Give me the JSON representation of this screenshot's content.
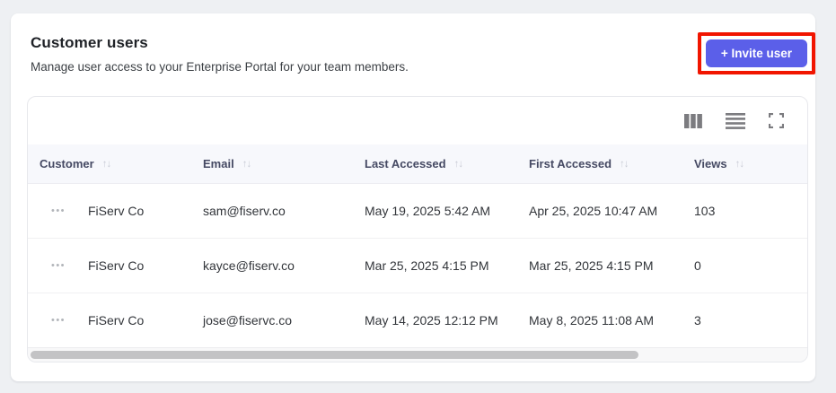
{
  "header": {
    "title": "Customer users",
    "subtitle": "Manage user access to your Enterprise Portal for your team members.",
    "invite_button_label": "+ Invite user"
  },
  "toolbar": {
    "icons": [
      "columns-icon",
      "row-density-icon",
      "fullscreen-icon"
    ]
  },
  "icons": {
    "sort_asc": "↑",
    "sort_desc": "↓",
    "row_menu": "•••"
  },
  "table": {
    "columns": [
      {
        "label": "Customer"
      },
      {
        "label": "Email"
      },
      {
        "label": "Last Accessed"
      },
      {
        "label": "First Accessed"
      },
      {
        "label": "Views"
      }
    ],
    "rows": [
      {
        "customer": "FiServ Co",
        "email": "sam@fiserv.co",
        "last_accessed": "May 19, 2025 5:42 AM",
        "first_accessed": "Apr 25, 2025 10:47 AM",
        "views": "103"
      },
      {
        "customer": "FiServ Co",
        "email": "kayce@fiserv.co",
        "last_accessed": "Mar 25, 2025 4:15 PM",
        "first_accessed": "Mar 25, 2025 4:15 PM",
        "views": "0"
      },
      {
        "customer": "FiServ Co",
        "email": "jose@fiservc.co",
        "last_accessed": "May 14, 2025 12:12 PM",
        "first_accessed": "May 8, 2025 11:08 AM",
        "views": "3"
      }
    ]
  },
  "colors": {
    "accent": "#5b5fe9",
    "annotation_highlight": "#f11500",
    "header_row_bg": "#f7f8fc",
    "page_bg": "#eef0f3"
  }
}
